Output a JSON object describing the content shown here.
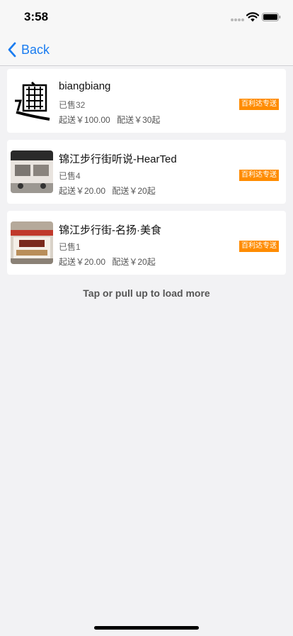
{
  "status_bar": {
    "time": "3:58"
  },
  "nav": {
    "back_label": "Back"
  },
  "stores": [
    {
      "name": "biangbiang",
      "sold": "已售32",
      "min_order": "起送￥100.00",
      "delivery_fee": "配送￥30起",
      "badge": "百利达专送",
      "thumb_text": "biáng"
    },
    {
      "name": "锦江步行街听说-HearTed",
      "sold": "已售4",
      "min_order": "起送￥20.00",
      "delivery_fee": "配送￥20起",
      "badge": "百利达专送",
      "thumb_text": "听说~HearTea"
    },
    {
      "name": "锦江步行街-名扬·美食",
      "sold": "已售1",
      "min_order": "起送￥20.00",
      "delivery_fee": "配送￥20起",
      "badge": "百利达专送",
      "thumb_text": "名扬·美食"
    }
  ],
  "load_more": "Tap or pull up to load more",
  "colors": {
    "accent": "#1a7cf0",
    "badge": "#ff8c00",
    "background": "#f2f2f4"
  }
}
